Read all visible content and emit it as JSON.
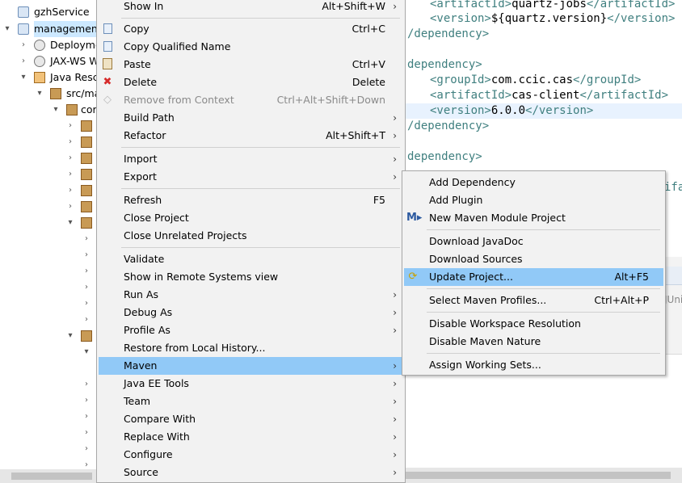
{
  "explorer": {
    "rows": [
      {
        "label": "gzhService",
        "icon": "project-icon"
      },
      {
        "label": "management",
        "icon": "maven-project-icon"
      },
      {
        "label": "Deployme",
        "icon": "deployment-icon"
      },
      {
        "label": "JAX-WS W",
        "icon": "web-services-icon"
      },
      {
        "label": "Java Resc",
        "icon": "java-resources-icon"
      },
      {
        "label": "src/ma",
        "icon": "source-folder-icon"
      },
      {
        "label": "cor",
        "icon": "package-icon"
      }
    ]
  },
  "editor": {
    "lines": [
      {
        "tag_open": "<artifactId>",
        "text": "quartz-jobs",
        "tag_close": "</artifactId>",
        "indent": 1
      },
      {
        "tag_open": "<version>",
        "text": "${quartz.version}",
        "tag_close": "</version>",
        "indent": 1
      },
      {
        "tag_open": "/dependency>",
        "text": "",
        "tag_close": "",
        "indent": 0
      },
      {
        "tag_open": "",
        "text": "",
        "tag_close": "",
        "indent": 0
      },
      {
        "tag_open": "dependency>",
        "text": "",
        "tag_close": "",
        "indent": 0
      },
      {
        "tag_open": "<groupId>",
        "text": "com.ccic.cas",
        "tag_close": "</groupId>",
        "indent": 1
      },
      {
        "tag_open": "<artifactId>",
        "text": "cas-client",
        "tag_close": "</artifactId>",
        "indent": 1
      },
      {
        "tag_open": "<version>",
        "text": "6.0.0",
        "tag_close": "</version>",
        "indent": 1
      },
      {
        "tag_open": "/dependency>",
        "text": "",
        "tag_close": "",
        "indent": 0
      },
      {
        "tag_open": "",
        "text": "",
        "tag_close": "",
        "indent": 0
      },
      {
        "tag_open": "dependency>",
        "text": "",
        "tag_close": "",
        "indent": 0
      },
      {
        "tag_open": "",
        "text": "",
        "tag_close": "ifa",
        "indent": 1
      }
    ],
    "junit_tab": "JUni"
  },
  "context_menu": {
    "items": [
      {
        "label": "Show In",
        "shortcut": "Alt+Shift+W",
        "submenu": true,
        "icon": ""
      },
      {
        "label": "Copy",
        "shortcut": "Ctrl+C",
        "icon": "copy-icon"
      },
      {
        "label": "Copy Qualified Name",
        "shortcut": "",
        "icon": "copy-qualified-icon"
      },
      {
        "label": "Paste",
        "shortcut": "Ctrl+V",
        "icon": "paste-icon"
      },
      {
        "label": "Delete",
        "shortcut": "Delete",
        "icon": "delete-icon"
      },
      {
        "label": "Remove from Context",
        "shortcut": "Ctrl+Alt+Shift+Down",
        "disabled": true,
        "icon": "remove-context-icon"
      },
      {
        "label": "Build Path",
        "shortcut": "",
        "submenu": true
      },
      {
        "label": "Refactor",
        "shortcut": "Alt+Shift+T",
        "submenu": true
      },
      {
        "label": "Import",
        "shortcut": "",
        "submenu": true
      },
      {
        "label": "Export",
        "shortcut": "",
        "submenu": true
      },
      {
        "label": "Refresh",
        "shortcut": "F5"
      },
      {
        "label": "Close Project",
        "shortcut": ""
      },
      {
        "label": "Close Unrelated Projects",
        "shortcut": ""
      },
      {
        "label": "Validate",
        "shortcut": ""
      },
      {
        "label": "Show in Remote Systems view",
        "shortcut": ""
      },
      {
        "label": "Run As",
        "shortcut": "",
        "submenu": true
      },
      {
        "label": "Debug As",
        "shortcut": "",
        "submenu": true
      },
      {
        "label": "Profile As",
        "shortcut": "",
        "submenu": true
      },
      {
        "label": "Restore from Local History...",
        "shortcut": ""
      },
      {
        "label": "Maven",
        "shortcut": "",
        "submenu": true,
        "active": true
      },
      {
        "label": "Java EE Tools",
        "shortcut": "",
        "submenu": true
      },
      {
        "label": "Team",
        "shortcut": "",
        "submenu": true
      },
      {
        "label": "Compare With",
        "shortcut": "",
        "submenu": true
      },
      {
        "label": "Replace With",
        "shortcut": "",
        "submenu": true
      },
      {
        "label": "Configure",
        "shortcut": "",
        "submenu": true
      },
      {
        "label": "Source",
        "shortcut": "",
        "submenu": true
      }
    ]
  },
  "maven_menu": {
    "items": [
      {
        "label": "Add Dependency",
        "shortcut": ""
      },
      {
        "label": "Add Plugin",
        "shortcut": ""
      },
      {
        "label": "New Maven Module Project",
        "shortcut": "",
        "icon": "maven-module-icon"
      },
      {
        "label": "Download JavaDoc",
        "shortcut": ""
      },
      {
        "label": "Download Sources",
        "shortcut": ""
      },
      {
        "label": "Update Project...",
        "shortcut": "Alt+F5",
        "icon": "update-project-icon",
        "active": true
      },
      {
        "label": "Select Maven Profiles...",
        "shortcut": "Ctrl+Alt+P"
      },
      {
        "label": "Disable Workspace Resolution",
        "shortcut": ""
      },
      {
        "label": "Disable Maven Nature",
        "shortcut": ""
      },
      {
        "label": "Assign Working Sets...",
        "shortcut": ""
      }
    ]
  },
  "colors": {
    "menu_bg": "#f2f2f2",
    "menu_highlight": "#91c9f7",
    "xml_tag": "#3f7f7f",
    "selection": "#cce8ff"
  }
}
